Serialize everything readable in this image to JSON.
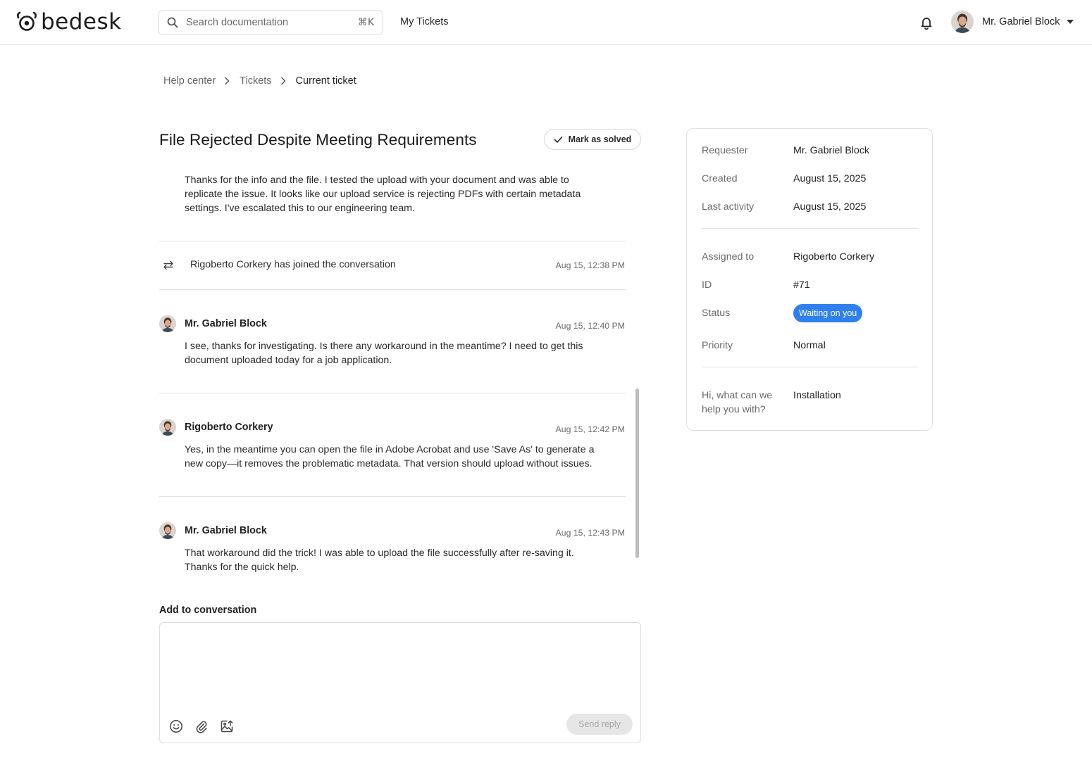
{
  "header": {
    "brand": "bedesk",
    "search_placeholder": "Search documentation",
    "search_shortcut": "⌘K",
    "nav_my_tickets": "My Tickets",
    "user_name": "Mr. Gabriel Block"
  },
  "breadcrumb": {
    "items": [
      "Help center",
      "Tickets",
      "Current ticket"
    ]
  },
  "ticket": {
    "title": "File Rejected Despite Meeting Requirements",
    "mark_solved": "Mark as solved"
  },
  "conversation": {
    "partial_message": {
      "line0": "Thanks for the info and the file. I tested the upload with your document and was able to",
      "line1": "replicate the issue. It looks like our upload service is rejecting PDFs with certain metadata",
      "line2": "settings. I've escalated this to our engineering team."
    },
    "event": {
      "text": "Rigoberto Corkery has joined the conversation",
      "time": "Aug 15, 12:38 PM"
    },
    "messages": [
      {
        "author": "Mr. Gabriel Block",
        "time": "Aug 15, 12:40 PM",
        "line1": "I see, thanks for investigating. Is there any workaround in the meantime? I need to get this",
        "line2": "document uploaded today for a job application."
      },
      {
        "author": "Rigoberto Corkery",
        "time": "Aug 15, 12:42 PM",
        "line1": "Yes, in the meantime you can open the file in Adobe Acrobat and use 'Save As' to generate a",
        "line2": "new copy—it removes the problematic metadata. That version should upload without issues."
      },
      {
        "author": "Mr. Gabriel Block",
        "time": "Aug 15, 12:43 PM",
        "line1": "That workaround did the trick! I was able to upload the file successfully after re-saving it.",
        "line2": "Thanks for the quick help."
      }
    ]
  },
  "reply": {
    "label": "Add to conversation",
    "send_label": "Send reply"
  },
  "details": {
    "requester_label": "Requester",
    "requester": "Mr. Gabriel Block",
    "created_label": "Created",
    "created": "August 15, 2025",
    "last_activity_label": "Last activity",
    "last_activity": "August 15, 2025",
    "assigned_label": "Assigned to",
    "assigned": "Rigoberto Corkery",
    "id_label": "ID",
    "id": "#71",
    "status_label": "Status",
    "status": "Waiting on you",
    "priority_label": "Priority",
    "priority": "Normal",
    "help_label_line1": "Hi, what can we",
    "help_label_line2": "help you with?",
    "help_value": "Installation"
  },
  "colors": {
    "accent": "#2f80ed",
    "border": "#e2e2e2",
    "muted_text": "#6a6a6a"
  }
}
